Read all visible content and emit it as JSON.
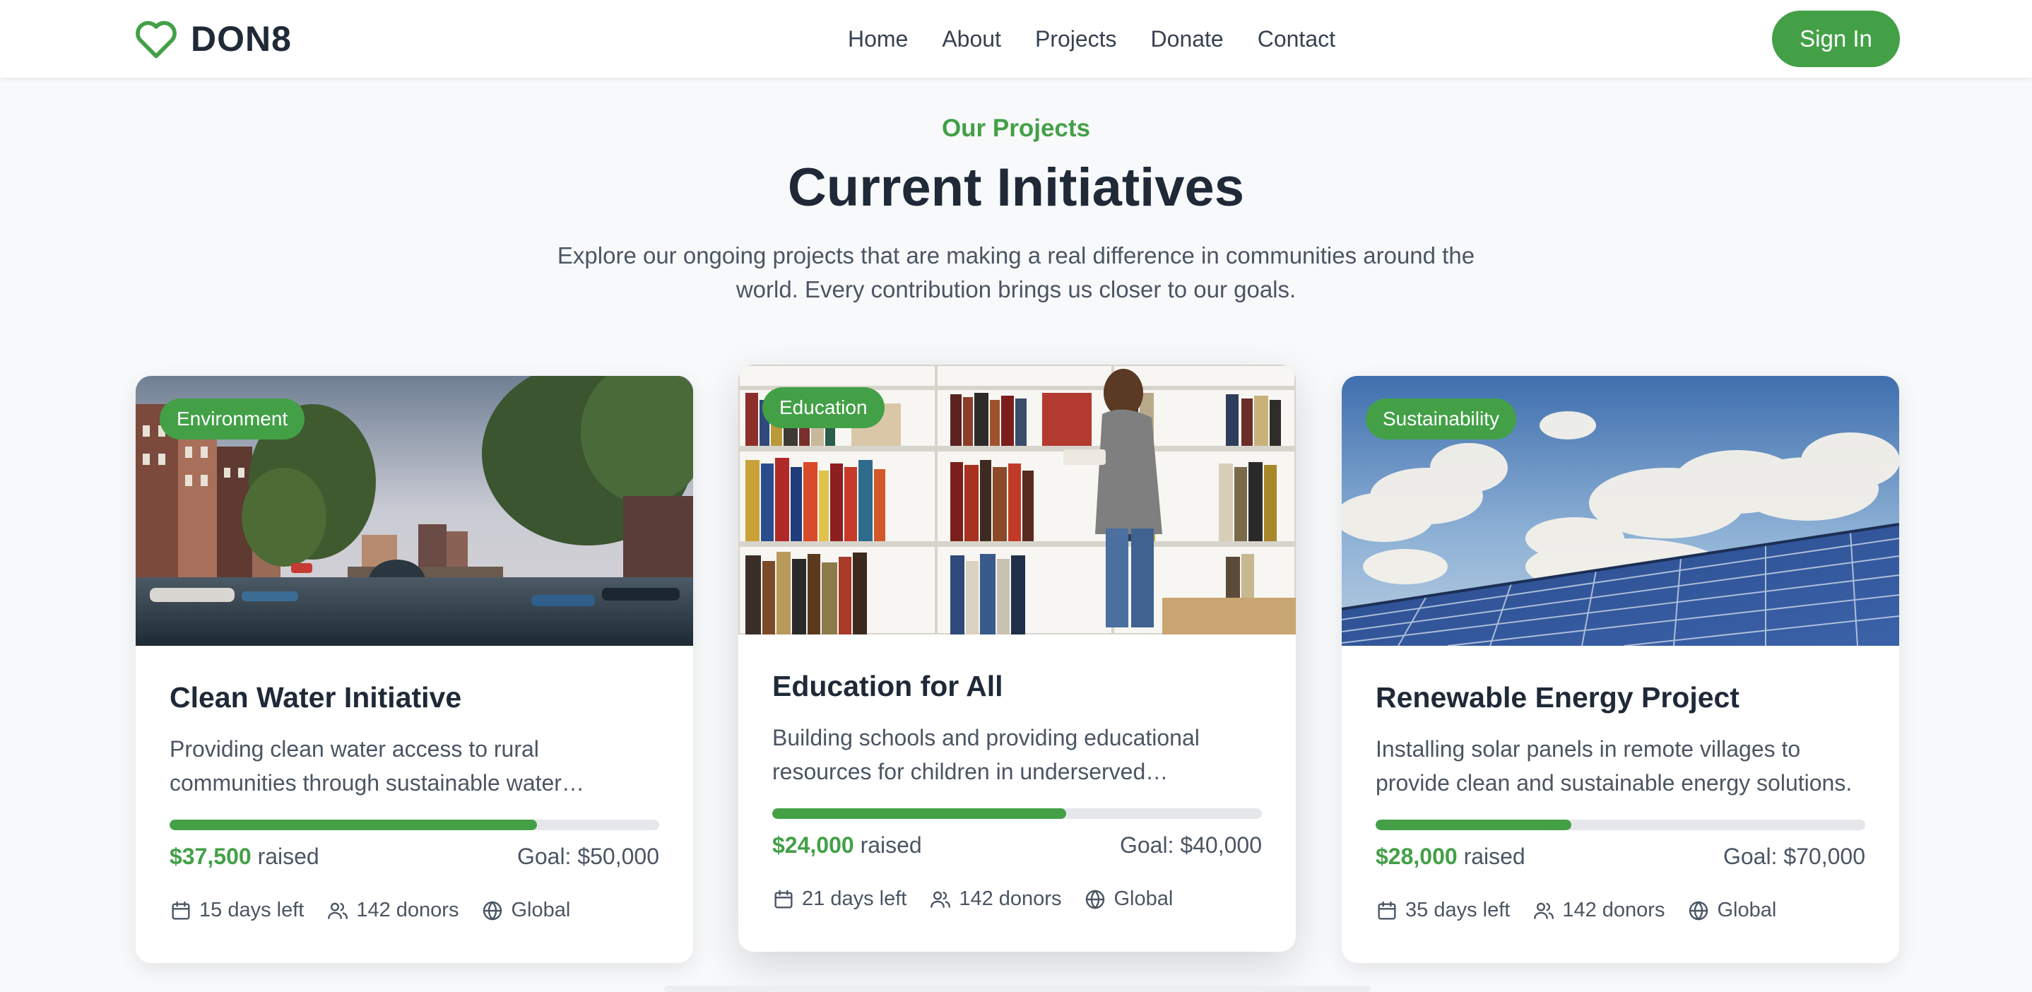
{
  "brand": {
    "name": "DON8",
    "logo_icon": "heart-icon"
  },
  "nav": {
    "items": [
      "Home",
      "About",
      "Projects",
      "Donate",
      "Contact"
    ],
    "signin_label": "Sign In"
  },
  "section": {
    "eyebrow": "Our Projects",
    "title": "Current Initiatives",
    "subtitle": "Explore our ongoing projects that are making a real difference in communities around the world. Every contribution brings us closer to our goals."
  },
  "colors": {
    "accent": "#43a047",
    "heading": "#1f2937",
    "text": "#4b5563",
    "track": "#e5e7eb"
  },
  "projects": [
    {
      "badge": "Environment",
      "image": "canal-city-photo",
      "title": "Clean Water Initiative",
      "description": "Providing clean water access to rural communities through sustainable water…",
      "progress": 0.75,
      "raised": "$37,500",
      "raised_label": "raised",
      "goal": "Goal: $50,000",
      "days_left": "15 days left",
      "donors": "142 donors",
      "location": "Global"
    },
    {
      "badge": "Education",
      "image": "library-photo",
      "title": "Education for All",
      "description": "Building schools and providing educational resources for children in underserved…",
      "progress": 0.6,
      "raised": "$24,000",
      "raised_label": "raised",
      "goal": "Goal: $40,000",
      "days_left": "21 days left",
      "donors": "142 donors",
      "location": "Global"
    },
    {
      "badge": "Sustainability",
      "image": "solar-panel-photo",
      "title": "Renewable Energy Project",
      "description": "Installing solar panels in remote villages to provide clean and sustainable energy solutions.",
      "progress": 0.4,
      "raised": "$28,000",
      "raised_label": "raised",
      "goal": "Goal: $70,000",
      "days_left": "35 days left",
      "donors": "142 donors",
      "location": "Global"
    }
  ]
}
